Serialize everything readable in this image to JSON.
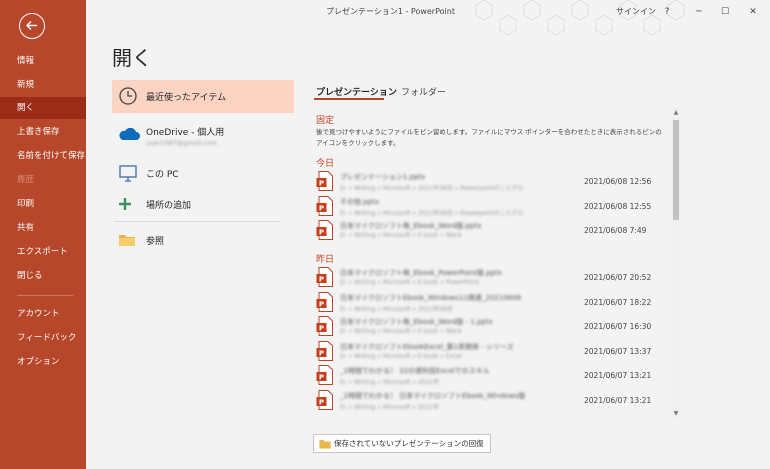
{
  "window": {
    "title": "プレゼンテーション1 - PowerPoint",
    "signin": "サインイン",
    "help": "?",
    "minimize": "─",
    "maximize": "☐",
    "close": "✕"
  },
  "colors": {
    "accent": "#b7472a",
    "selected": "#fbd3c3",
    "section": "#c43e1c"
  },
  "nav": {
    "items": [
      {
        "label": "情報"
      },
      {
        "label": "新規"
      },
      {
        "label": "開く"
      },
      {
        "label": "上書き保存"
      },
      {
        "label": "名前を付けて保存"
      },
      {
        "label": "履歴"
      },
      {
        "label": "印刷"
      },
      {
        "label": "共有"
      },
      {
        "label": "エクスポート"
      },
      {
        "label": "閉じる"
      },
      {
        "label": "アカウント"
      },
      {
        "label": "フィードバック"
      },
      {
        "label": "オプション"
      }
    ]
  },
  "page": {
    "title": "開く"
  },
  "locations": {
    "recent": "最近使ったアイテム",
    "onedrive": "OneDrive - 個人用",
    "onedrive_account": "user1987@gmail.com",
    "thispc": "この PC",
    "add_place": "場所の追加",
    "browse": "参照"
  },
  "tabs": {
    "presentations": "プレゼンテーション",
    "folders": "フォルダー"
  },
  "sections": {
    "pinned": "固定",
    "pinned_desc": "後で見つけやすいようにファイルをピン留めします。ファイルにマウス ポインターを合わせたときに表示されるピンのアイコンをクリックします。",
    "today": "今日",
    "yesterday": "昨日"
  },
  "files_today": [
    {
      "name": "プレゼンテーション1.pptx",
      "path": "D: » Writing » Microsoft » 2021年06月 » PowerpointのことがＯ",
      "date": "2021/06/08 12:56"
    },
    {
      "name": "その他.pptx",
      "path": "D: » Writing » Microsoft » 2021年06月 » PowerpointのことがＯ",
      "date": "2021/06/08 12:55"
    },
    {
      "name": "日本マイクロソフト株_Ebook_Word版.pptx",
      "path": "D: » Writing » Microsoft » E-book » Word",
      "date": "2021/06/08 7:49"
    }
  ],
  "files_yesterday": [
    {
      "name": "日本マイクロソフト株_Ebook_PowerPoint版.pptx",
      "path": "D: » Writing » Microsoft » E-book » PowerPoint",
      "date": "2021/06/07 20:52"
    },
    {
      "name": "日本マイクロソフトEbook_Windows11関連_20210608",
      "path": "D: » Writing » Microsoft » 2021年06月",
      "date": "2021/06/07 18:22"
    },
    {
      "name": "日本マイクロソフト株_Ebook_Word版 - 1.pptx",
      "path": "D: » Writing » Microsoft » E-book » Word",
      "date": "2021/06/07 16:30"
    },
    {
      "name": "日本マイクロソフトEbookExcel_第1章関係 - シリーズ",
      "path": "D: » Writing » Microsoft » E-book » Excel",
      "date": "2021/06/07 13:37"
    },
    {
      "name": "_1時間でわかる！ 32の便利技Excelでのスキル",
      "path": "D: » Writing » Microsoft » 2021年",
      "date": "2021/06/07 13:21"
    },
    {
      "name": "_1時間でわかる！ 日本マイクロソフトEbook_Windows版",
      "path": "D: » Writing » Microsoft » 2021年",
      "date": "2021/06/07 13:21"
    }
  ],
  "recover_button": "保存されていないプレゼンテーションの回復"
}
